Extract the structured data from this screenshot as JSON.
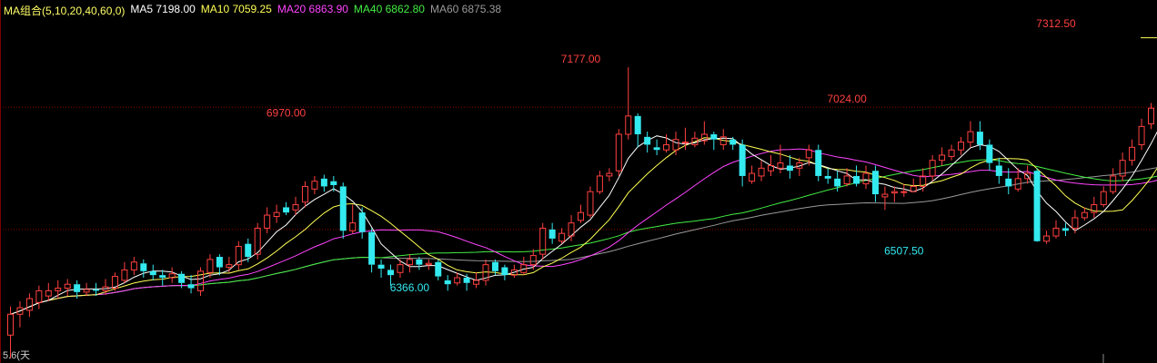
{
  "legend": {
    "title": "MA组合(5,10,20,40,60,0)",
    "items": [
      {
        "label": "MA5 7198.00",
        "color": "#ffffff"
      },
      {
        "label": "MA10 7059.25",
        "color": "#ffff55"
      },
      {
        "label": "MA20 6863.90",
        "color": "#ff44ff"
      },
      {
        "label": "MA40 6862.80",
        "color": "#44ee44"
      },
      {
        "label": "MA60 6875.38",
        "color": "#999999"
      }
    ]
  },
  "corner_label": "5.6(天",
  "colors": {
    "up": "#ff4040",
    "down": "#33eaf0",
    "grid": "#8a0000",
    "background": "#000000"
  },
  "chart_data": {
    "type": "candlestick",
    "ylim": [
      6050,
      7400
    ],
    "reference_lines": [
      7024,
      6555
    ],
    "annotations": [
      {
        "text": "6970.00",
        "index": 29,
        "price": 6970.0,
        "color": "#ff4040",
        "position": "above"
      },
      {
        "text": "6366.00",
        "index": 42,
        "price": 6366.0,
        "color": "#33eaf0",
        "position": "below"
      },
      {
        "text": "7177.00",
        "index": 60,
        "price": 7177.0,
        "color": "#ff4040",
        "position": "above"
      },
      {
        "text": "7024.00",
        "index": 88,
        "price": 7024.0,
        "color": "#ff4040",
        "position": "above"
      },
      {
        "text": "6507.50",
        "index": 94,
        "price": 6507.5,
        "color": "#33eaf0",
        "position": "below"
      },
      {
        "text": "7312.50",
        "index": 110,
        "price": 7312.5,
        "color": "#ff4040",
        "position": "above"
      }
    ],
    "candles": [
      [
        6150,
        6230,
        6260,
        6060
      ],
      [
        6230,
        6255,
        6280,
        6180
      ],
      [
        6245,
        6290,
        6310,
        6220
      ],
      [
        6275,
        6320,
        6340,
        6250
      ],
      [
        6300,
        6320,
        6350,
        6280
      ],
      [
        6320,
        6330,
        6360,
        6290
      ],
      [
        6330,
        6345,
        6365,
        6300
      ],
      [
        6345,
        6315,
        6360,
        6290
      ],
      [
        6315,
        6325,
        6350,
        6300
      ],
      [
        6325,
        6320,
        6350,
        6300
      ],
      [
        6320,
        6335,
        6365,
        6305
      ],
      [
        6330,
        6375,
        6390,
        6320
      ],
      [
        6360,
        6400,
        6430,
        6350
      ],
      [
        6400,
        6430,
        6450,
        6380
      ],
      [
        6425,
        6395,
        6440,
        6370
      ],
      [
        6395,
        6380,
        6420,
        6360
      ],
      [
        6380,
        6370,
        6400,
        6340
      ],
      [
        6370,
        6385,
        6410,
        6350
      ],
      [
        6385,
        6350,
        6395,
        6330
      ],
      [
        6345,
        6330,
        6380,
        6310
      ],
      [
        6320,
        6395,
        6410,
        6300
      ],
      [
        6390,
        6440,
        6460,
        6370
      ],
      [
        6450,
        6410,
        6460,
        6380
      ],
      [
        6410,
        6420,
        6450,
        6390
      ],
      [
        6420,
        6490,
        6510,
        6400
      ],
      [
        6500,
        6450,
        6520,
        6430
      ],
      [
        6460,
        6560,
        6580,
        6440
      ],
      [
        6560,
        6610,
        6640,
        6540
      ],
      [
        6605,
        6620,
        6650,
        6580
      ],
      [
        6640,
        6620,
        6660,
        6610
      ],
      [
        6630,
        6650,
        6680,
        6610
      ],
      [
        6660,
        6720,
        6740,
        6640
      ],
      [
        6710,
        6740,
        6760,
        6690
      ],
      [
        6750,
        6720,
        6765,
        6700
      ],
      [
        6740,
        6725,
        6760,
        6700
      ],
      [
        6720,
        6550,
        6735,
        6520
      ],
      [
        6550,
        6580,
        6650,
        6540
      ],
      [
        6620,
        6545,
        6640,
        6520
      ],
      [
        6545,
        6420,
        6560,
        6390
      ],
      [
        6420,
        6405,
        6440,
        6370
      ],
      [
        6400,
        6380,
        6420,
        6340
      ],
      [
        6390,
        6420,
        6440,
        6370
      ],
      [
        6420,
        6440,
        6460,
        6390
      ],
      [
        6440,
        6420,
        6450,
        6400
      ],
      [
        6420,
        6425,
        6440,
        6400
      ],
      [
        6430,
        6375,
        6440,
        6360
      ],
      [
        6360,
        6345,
        6380,
        6320
      ],
      [
        6350,
        6370,
        6390,
        6340
      ],
      [
        6370,
        6350,
        6385,
        6320
      ],
      [
        6345,
        6360,
        6390,
        6330
      ],
      [
        6360,
        6420,
        6440,
        6340
      ],
      [
        6430,
        6395,
        6440,
        6380
      ],
      [
        6410,
        6380,
        6420,
        6360
      ],
      [
        6380,
        6400,
        6420,
        6370
      ],
      [
        6390,
        6420,
        6450,
        6380
      ],
      [
        6420,
        6455,
        6480,
        6400
      ],
      [
        6460,
        6560,
        6580,
        6440
      ],
      [
        6555,
        6520,
        6580,
        6500
      ],
      [
        6510,
        6540,
        6560,
        6500
      ],
      [
        6530,
        6580,
        6610,
        6510
      ],
      [
        6590,
        6620,
        6650,
        6580
      ],
      [
        6610,
        6700,
        6720,
        6600
      ],
      [
        6700,
        6760,
        6780,
        6690
      ],
      [
        6760,
        6770,
        6790,
        6740
      ],
      [
        6780,
        6920,
        6940,
        6760
      ],
      [
        6920,
        6990,
        7177,
        6900
      ],
      [
        6990,
        6920,
        7000,
        6870
      ],
      [
        6910,
        6880,
        6930,
        6850
      ],
      [
        6870,
        6860,
        6900,
        6840
      ],
      [
        6860,
        6880,
        6920,
        6850
      ],
      [
        6860,
        6900,
        6930,
        6840
      ],
      [
        6890,
        6890,
        6945,
        6860
      ],
      [
        6880,
        6905,
        6930,
        6870
      ],
      [
        6895,
        6920,
        6970,
        6880
      ],
      [
        6920,
        6900,
        6930,
        6860
      ],
      [
        6880,
        6910,
        6940,
        6860
      ],
      [
        6900,
        6880,
        6910,
        6860
      ],
      [
        6880,
        6760,
        6900,
        6720
      ],
      [
        6740,
        6770,
        6800,
        6730
      ],
      [
        6760,
        6790,
        6820,
        6740
      ],
      [
        6780,
        6800,
        6840,
        6760
      ],
      [
        6790,
        6810,
        6880,
        6770
      ],
      [
        6800,
        6780,
        6840,
        6750
      ],
      [
        6790,
        6810,
        6830,
        6760
      ],
      [
        6830,
        6860,
        6880,
        6800
      ],
      [
        6860,
        6760,
        6880,
        6740
      ],
      [
        6760,
        6750,
        6790,
        6730
      ],
      [
        6750,
        6720,
        6780,
        6700
      ],
      [
        6730,
        6760,
        6790,
        6720
      ],
      [
        6760,
        6730,
        6800,
        6720
      ],
      [
        6730,
        6770,
        6800,
        6710
      ],
      [
        6780,
        6690,
        6800,
        6660
      ],
      [
        6680,
        6690,
        6720,
        6630
      ],
      [
        6695,
        6700,
        6720,
        6660
      ],
      [
        6700,
        6700,
        6730,
        6680
      ],
      [
        6700,
        6720,
        6750,
        6700
      ],
      [
        6720,
        6760,
        6790,
        6700
      ],
      [
        6760,
        6820,
        6840,
        6740
      ],
      [
        6820,
        6840,
        6870,
        6800
      ],
      [
        6835,
        6860,
        6880,
        6820
      ],
      [
        6860,
        6890,
        6910,
        6840
      ],
      [
        6890,
        6930,
        6970,
        6870
      ],
      [
        6930,
        6880,
        6970,
        6860
      ],
      [
        6880,
        6810,
        6900,
        6780
      ],
      [
        6800,
        6760,
        6830,
        6730
      ],
      [
        6750,
        6720,
        6790,
        6690
      ],
      [
        6710,
        6750,
        6790,
        6700
      ],
      [
        6750,
        6770,
        6800,
        6730
      ],
      [
        6780,
        6510,
        6790,
        6507.5
      ],
      [
        6510,
        6530,
        6550,
        6500
      ],
      [
        6530,
        6560,
        6590,
        6520
      ],
      [
        6560,
        6550,
        6580,
        6530
      ],
      [
        6560,
        6600,
        6630,
        6540
      ],
      [
        6600,
        6620,
        6640,
        6590
      ],
      [
        6620,
        6650,
        6680,
        6600
      ],
      [
        6650,
        6700,
        6720,
        6640
      ],
      [
        6700,
        6760,
        6790,
        6690
      ],
      [
        6760,
        6820,
        6850,
        6740
      ],
      [
        6820,
        6870,
        6900,
        6800
      ],
      [
        6880,
        6950,
        6980,
        6860
      ],
      [
        6960,
        7020,
        7040,
        6940
      ],
      [
        7030,
        7110,
        7140,
        7010
      ],
      [
        7110,
        7180,
        7210,
        7090
      ],
      [
        7180,
        7250,
        7280,
        7160
      ],
      [
        7250,
        7280,
        7312.5,
        7230
      ],
      [
        7260,
        7290,
        7300,
        7240
      ]
    ]
  }
}
